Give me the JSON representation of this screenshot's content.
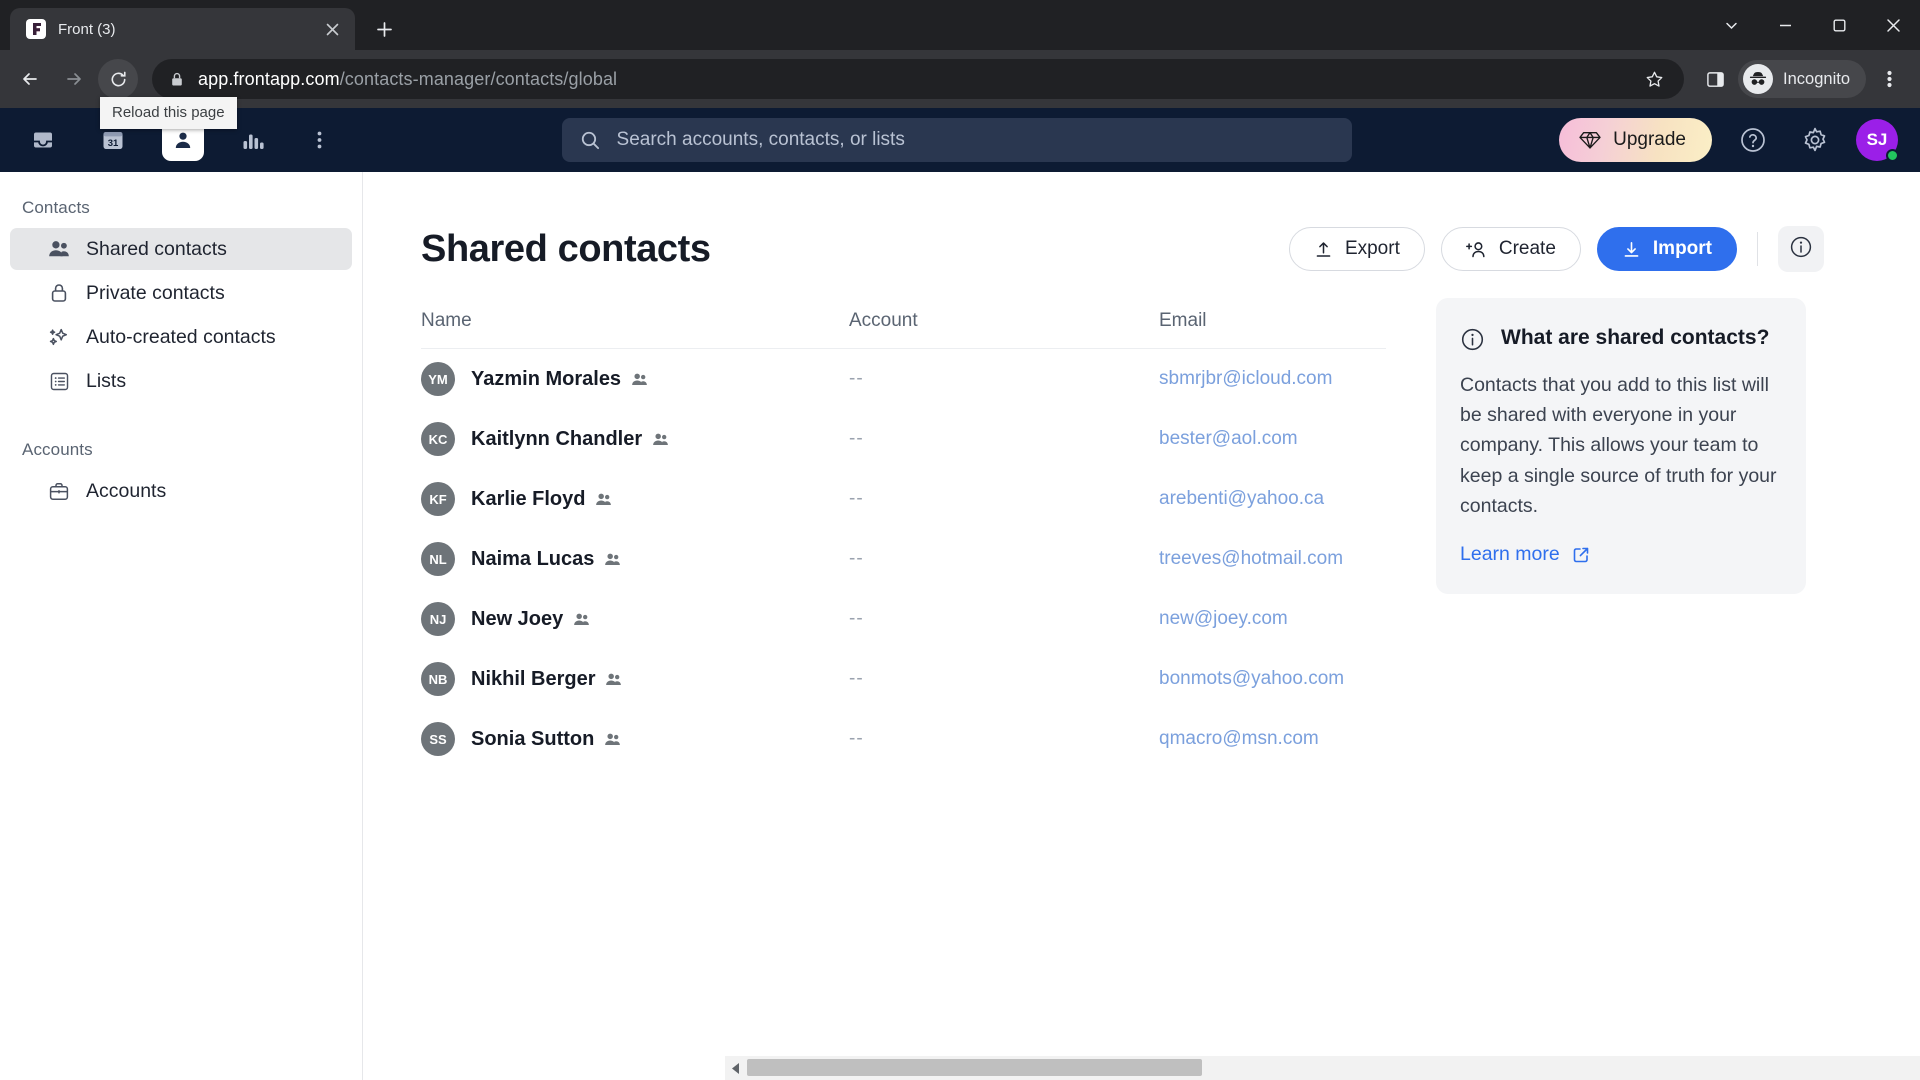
{
  "browser": {
    "tab": {
      "title": "Front (3)",
      "favicon": "front-logo-icon",
      "close_icon": "close-icon"
    },
    "new_tab_icon": "plus-icon",
    "window_controls": [
      {
        "name": "minimize-to-tray-chevron",
        "icon": "chevron-down-icon"
      },
      {
        "name": "minimize",
        "icon": "minimize-icon"
      },
      {
        "name": "maximize",
        "icon": "maximize-icon"
      },
      {
        "name": "close",
        "icon": "close-icon"
      }
    ],
    "nav": {
      "back_icon": "arrow-left-icon",
      "forward_icon": "arrow-right-icon",
      "reload_icon": "reload-icon"
    },
    "tooltip": "Reload this page",
    "address": {
      "lock_icon": "lock-icon",
      "host": "app.frontapp.com",
      "path": "/contacts-manager/contacts/global",
      "bookmark_icon": "star-icon"
    },
    "toolbar_right": {
      "side_panel_icon": "side-panel-icon",
      "incognito_label": "Incognito",
      "incognito_icon": "incognito-hat-icon",
      "menu_icon": "three-dots-vertical-icon"
    }
  },
  "app_header": {
    "nav_items": [
      {
        "name": "inbox",
        "icon": "inbox-icon",
        "active": false
      },
      {
        "name": "calendar",
        "icon": "calendar-31-icon",
        "active": false
      },
      {
        "name": "contacts",
        "icon": "contacts-person-icon",
        "active": true
      },
      {
        "name": "analytics",
        "icon": "bar-chart-icon",
        "active": false
      }
    ],
    "more_icon": "three-dots-vertical-icon",
    "search": {
      "placeholder": "Search accounts, contacts, or lists",
      "value": "",
      "icon": "search-icon"
    },
    "upgrade_label": "Upgrade",
    "upgrade_icon": "diamond-icon",
    "help_icon": "help-circle-icon",
    "settings_icon": "gear-icon",
    "avatar_initials": "SJ",
    "avatar_color": "#9b1fe8",
    "presence_color": "#22c55e"
  },
  "sidebar": {
    "sections": [
      {
        "title": "Contacts",
        "items": [
          {
            "label": "Shared contacts",
            "icon": "two-people-icon",
            "selected": true
          },
          {
            "label": "Private contacts",
            "icon": "lock-icon",
            "selected": false
          },
          {
            "label": "Auto-created contacts",
            "icon": "sparkles-icon",
            "selected": false
          },
          {
            "label": "Lists",
            "icon": "list-icon",
            "selected": false
          }
        ]
      },
      {
        "title": "Accounts",
        "items": [
          {
            "label": "Accounts",
            "icon": "briefcase-icon",
            "selected": false
          }
        ]
      }
    ]
  },
  "main": {
    "title": "Shared contacts",
    "buttons": {
      "export": {
        "label": "Export",
        "icon": "upload-arrow-icon"
      },
      "create": {
        "label": "Create",
        "icon": "person-plus-icon"
      },
      "import": {
        "label": "Import",
        "icon": "download-arrow-icon",
        "color": "#2f6fed"
      },
      "info": {
        "icon": "info-circle-icon"
      }
    },
    "table": {
      "columns": [
        "Name",
        "Account",
        "Email"
      ],
      "rows": [
        {
          "initials": "YM",
          "name": "Yazmin Morales",
          "shared_icon": "two-people-icon",
          "account": "--",
          "email": "sbmrjbr@icloud.com"
        },
        {
          "initials": "KC",
          "name": "Kaitlynn Chandler",
          "shared_icon": "two-people-icon",
          "account": "--",
          "email": "bester@aol.com"
        },
        {
          "initials": "KF",
          "name": "Karlie Floyd",
          "shared_icon": "two-people-icon",
          "account": "--",
          "email": "arebenti@yahoo.ca"
        },
        {
          "initials": "NL",
          "name": "Naima Lucas",
          "shared_icon": "two-people-icon",
          "account": "--",
          "email": "treeves@hotmail.com"
        },
        {
          "initials": "NJ",
          "name": "New Joey",
          "shared_icon": "two-people-icon",
          "account": "--",
          "email": "new@joey.com"
        },
        {
          "initials": "NB",
          "name": "Nikhil Berger",
          "shared_icon": "two-people-icon",
          "account": "--",
          "email": "bonmots@yahoo.com"
        },
        {
          "initials": "SS",
          "name": "Sonia Sutton",
          "shared_icon": "two-people-icon",
          "account": "--",
          "email": "qmacro@msn.com"
        }
      ]
    },
    "info_panel": {
      "icon": "info-circle-icon",
      "title": "What are shared contacts?",
      "body": "Contacts that you add to this list will be shared with everyone in your company. This allows your team to keep a single source of truth for your contacts.",
      "link_label": "Learn more",
      "link_icon": "external-link-icon"
    }
  },
  "scrollbar": {
    "left_arrow_icon": "triangle-left-icon",
    "right_arrow_icon": "triangle-right-icon"
  }
}
